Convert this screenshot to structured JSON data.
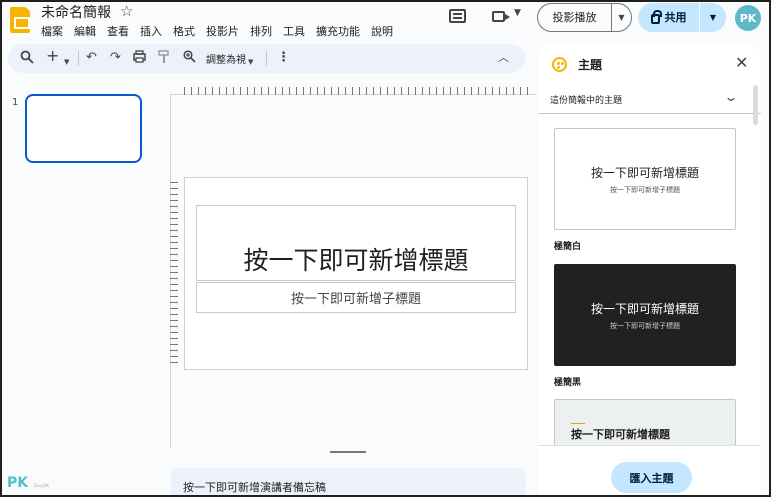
{
  "header": {
    "doc_title": "未命名簡報",
    "star_glyph": "☆",
    "menu": [
      "檔案",
      "編輯",
      "查看",
      "插入",
      "格式",
      "投影片",
      "排列",
      "工具",
      "擴充功能",
      "說明"
    ],
    "present_label": "投影播放",
    "share_label": "共用",
    "avatar_initials": "PK"
  },
  "toolbar": {
    "zoom_label": "調整為視",
    "icons": [
      "search-icon",
      "add-icon",
      "undo-icon",
      "redo-icon",
      "print-icon",
      "paint-format-icon",
      "zoom-icon",
      "more-icon",
      "collapse-icon"
    ]
  },
  "filmstrip": {
    "slide_number": "1"
  },
  "slide": {
    "title_placeholder": "按一下即可新增標題",
    "subtitle_placeholder": "按一下即可新增子標題"
  },
  "notes": {
    "placeholder": "按一下即可新增演講者備忘稿"
  },
  "watermark": {
    "text": "PK",
    "subtext": "EasyDK"
  },
  "theme_panel": {
    "title": "主題",
    "section_label": "這份簡報中的主題",
    "themes": [
      {
        "name": "極簡白",
        "preview_title": "按一下即可新增標題",
        "preview_subtitle": "按一下即可新增子標題"
      },
      {
        "name": "極簡黑",
        "preview_title": "按一下即可新增標題",
        "preview_subtitle": "按一下即可新增子標題"
      },
      {
        "name": "",
        "preview_title": "按一下即可新增標題"
      }
    ],
    "import_label": "匯入主題"
  },
  "colors": {
    "accent_blue": "#0b57d0",
    "share_bg": "#c2e7ff",
    "slides_yellow": "#f4b400",
    "toolbar_bg": "#edf2fa",
    "dark_theme_bg": "#212121"
  }
}
